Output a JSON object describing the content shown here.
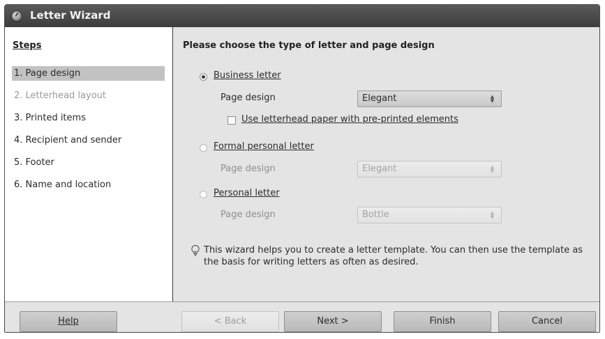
{
  "window": {
    "title": "Letter Wizard"
  },
  "steps": {
    "title": "Steps",
    "items": [
      {
        "label": "1. Page design"
      },
      {
        "label": "2. Letterhead layout"
      },
      {
        "label": "3. Printed items"
      },
      {
        "label": "4. Recipient and sender"
      },
      {
        "label": "5. Footer"
      },
      {
        "label": "6. Name and location"
      }
    ],
    "selected_index": 0
  },
  "main": {
    "heading": "Please choose the type of letter and page design",
    "options": [
      {
        "label": "Business letter",
        "checked": true,
        "design_label": "Page design",
        "design_value": "Elegant"
      },
      {
        "label": "Formal personal letter",
        "checked": false,
        "design_label": "Page design",
        "design_value": "Elegant"
      },
      {
        "label": "Personal letter",
        "checked": false,
        "design_label": "Page design",
        "design_value": "Bottle"
      }
    ],
    "letterhead_checkbox": {
      "label": "Use letterhead paper with pre-printed elements",
      "checked": false
    },
    "hint": "This wizard helps you to create a letter template. You can then use the template as the basis for writing letters as often as desired."
  },
  "buttons": {
    "help": "Help",
    "back": "< Back",
    "next": "Next >",
    "finish": "Finish",
    "cancel": "Cancel"
  }
}
